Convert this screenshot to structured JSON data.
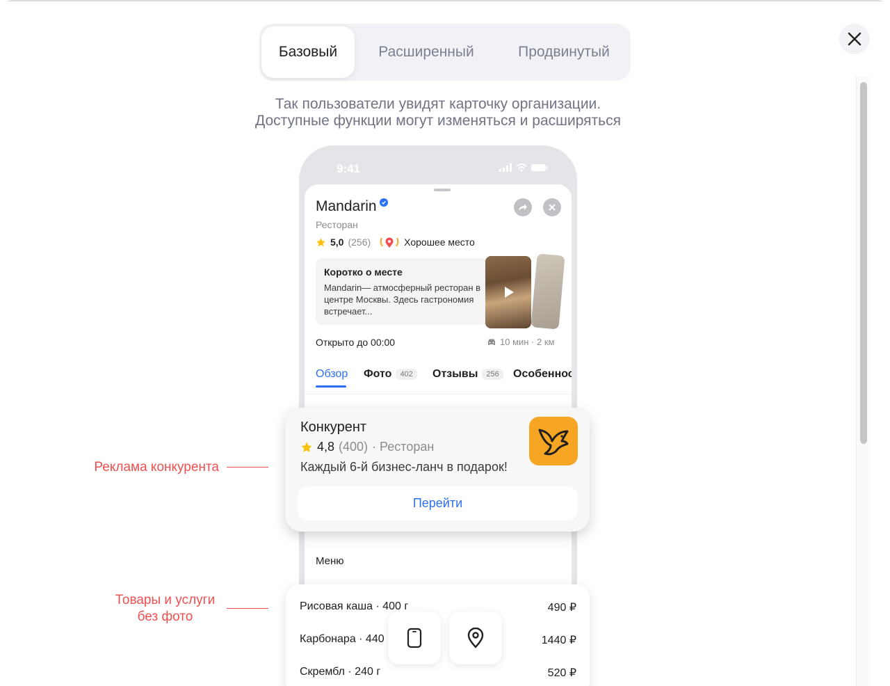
{
  "tabs": [
    {
      "label": "Базовый",
      "active": true
    },
    {
      "label": "Расширенный",
      "active": false
    },
    {
      "label": "Продвинутый",
      "active": false
    }
  ],
  "subtitle": {
    "line1": "Так пользователи увидят карточку организации.",
    "line2": "Доступные функции могут изменяться и расширяться"
  },
  "phone": {
    "status_time": "9:41",
    "org": {
      "name": "Mandarin",
      "category": "Ресторан",
      "rating": "5,0",
      "reviews_count": "(256)",
      "badge": "Хорошее место"
    },
    "about": {
      "title": "Коротко о месте",
      "text": "Mandarin— атмосферный ресторан в центре Москвы. Здесь гастрономия встречает..."
    },
    "hours": "Открыто до 00:00",
    "route": "10 мин · 2 км",
    "tabs": [
      {
        "label": "Обзор",
        "count": ""
      },
      {
        "label": "Фото",
        "count": "402"
      },
      {
        "label": "Отзывы",
        "count": "256"
      },
      {
        "label": "Особеннос",
        "count": ""
      }
    ],
    "menu_label": "Меню"
  },
  "ad": {
    "title": "Конкурент",
    "rating": "4,8",
    "reviews": "(400)",
    "category": "· Ресторан",
    "text": "Каждый 6-й бизнес-ланч в подарок!",
    "button": "Перейти"
  },
  "annotations": {
    "ad_label": "Реклама конкурента",
    "goods_label_line1": "Товары и услуги",
    "goods_label_line2": "без фото"
  },
  "goods": [
    {
      "name": "Рисовая каша · 400 г",
      "price": "490 ₽"
    },
    {
      "name": "Карбонара · 440",
      "price": "1440 ₽"
    },
    {
      "name": "Скрембл · 240 г",
      "price": "520 ₽"
    }
  ],
  "colors": {
    "accent_blue": "#2a6ff4",
    "annotation_red": "#f04f4f",
    "ad_logo_bg": "#f6a623",
    "star": "#ffc107"
  }
}
